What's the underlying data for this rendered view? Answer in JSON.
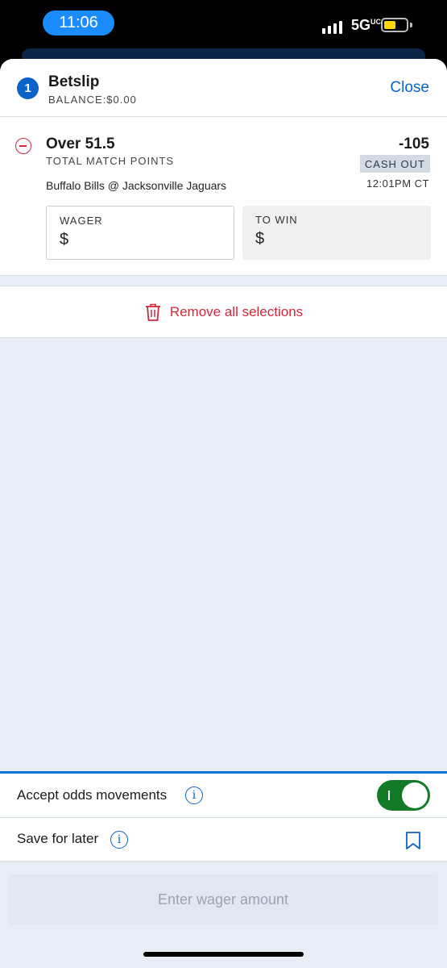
{
  "status_bar": {
    "time": "11:06",
    "network": "5G",
    "network_suffix": "UC",
    "battery_color": "#ffd60a"
  },
  "betslip": {
    "count": "1",
    "title": "Betslip",
    "balance": "BALANCE:$0.00",
    "close_label": "Close"
  },
  "bet": {
    "selection": "Over 51.5",
    "market": "TOTAL MATCH POINTS",
    "matchup": "Buffalo Bills @ Jacksonville Jaguars",
    "odds": "-105",
    "cashout_label": "CASH OUT",
    "event_time": "12:01PM CT",
    "wager_label": "WAGER",
    "wager_value": "$",
    "to_win_label": "TO WIN",
    "to_win_value": "$"
  },
  "remove_all_label": "Remove all selections",
  "settings": {
    "accept_odds_label": "Accept odds movements",
    "accept_odds_enabled": true,
    "save_later_label": "Save for later"
  },
  "submit_label": "Enter wager amount",
  "colors": {
    "accent": "#0a63c9",
    "danger": "#d0293a",
    "toggle_on": "#137a27"
  }
}
